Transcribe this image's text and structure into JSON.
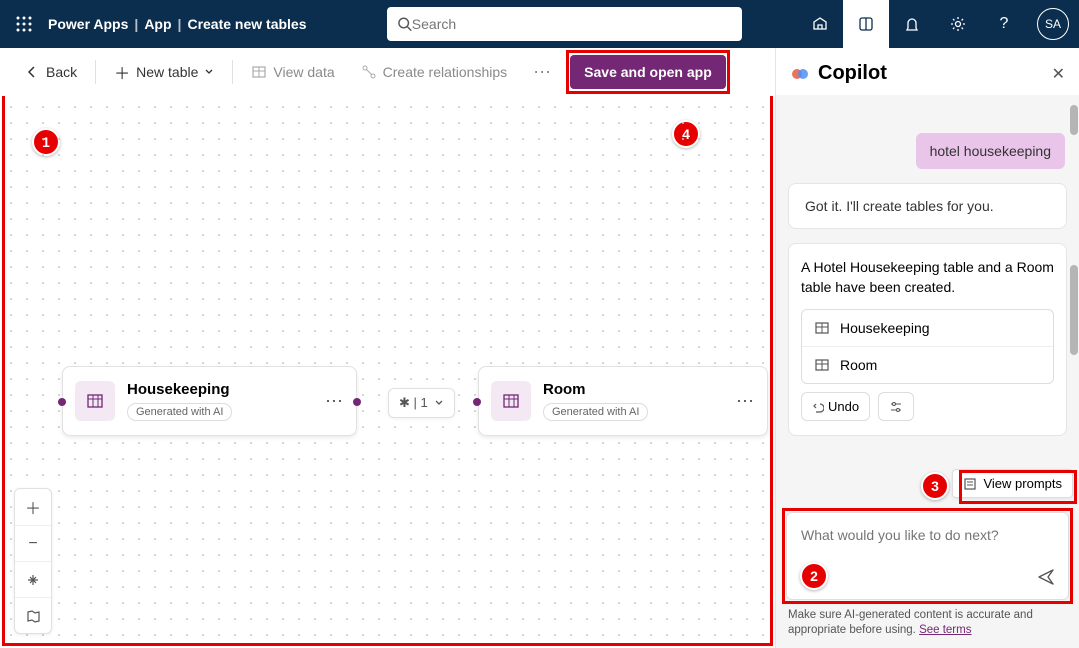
{
  "header": {
    "product": "Power Apps",
    "crumb1": "App",
    "crumb2": "Create new tables",
    "search_placeholder": "Search",
    "avatar_initials": "SA"
  },
  "toolbar": {
    "back": "Back",
    "new_table": "New table",
    "view_data": "View data",
    "create_rel": "Create relationships",
    "save_open": "Save and open app"
  },
  "cards": {
    "housekeeping": {
      "title": "Housekeeping",
      "badge": "Generated with AI"
    },
    "room": {
      "title": "Room",
      "badge": "Generated with AI"
    },
    "relation": "✱ | 1"
  },
  "copilot": {
    "title": "Copilot",
    "user_msg": "hotel housekeeping",
    "bot_msg1": "Got it. I'll create tables for you.",
    "bot_msg2": "A Hotel Housekeeping table and a Room table have been created.",
    "table1": "Housekeeping",
    "table2": "Room",
    "undo": "Undo",
    "view_prompts": "View prompts",
    "input_placeholder": "What would you like to do next?",
    "disclaimer_pre": "Make sure AI-generated content is accurate and appropriate before using. ",
    "disclaimer_link": "See terms"
  },
  "callouts": {
    "c1": "1",
    "c2": "2",
    "c3": "3",
    "c4": "4"
  }
}
